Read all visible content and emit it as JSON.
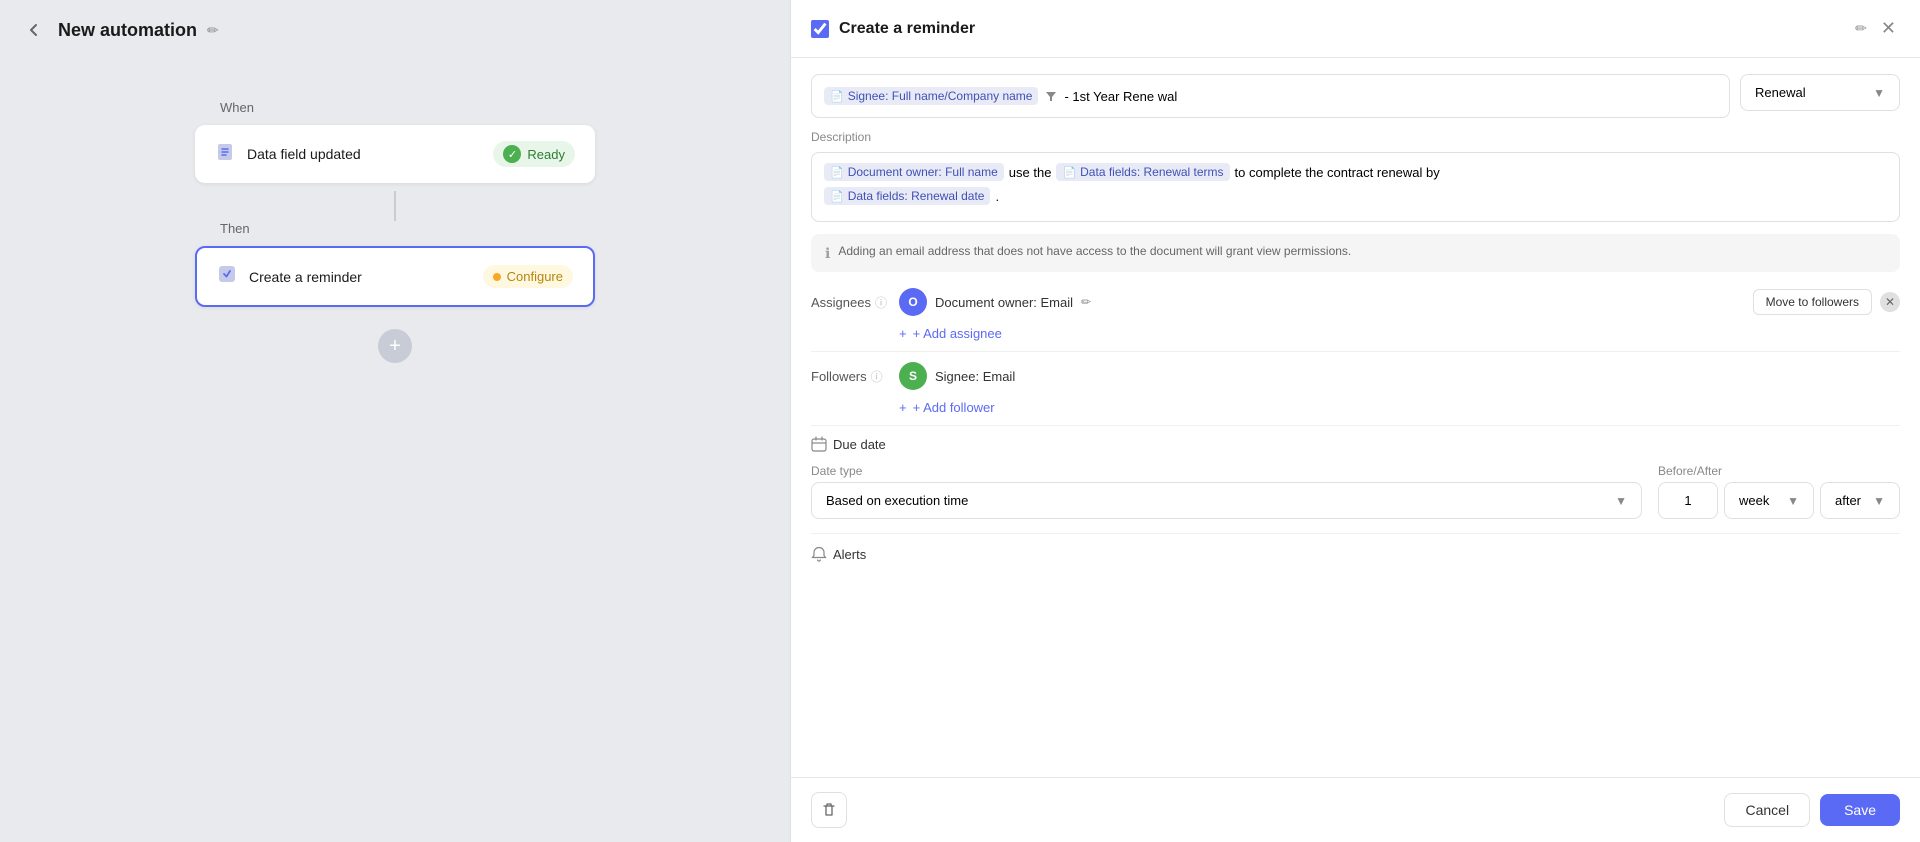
{
  "left": {
    "back_button": "‹",
    "title": "New automation",
    "edit_icon": "✏",
    "when_label": "When",
    "trigger_card": {
      "icon": "📄",
      "label": "Data field updated",
      "status": "Ready"
    },
    "then_label": "Then",
    "action_card": {
      "icon": "☑",
      "label": "Create a reminder",
      "status": "Configure"
    },
    "add_button": "+"
  },
  "right": {
    "title": "Create a reminder",
    "edit_icon": "✏",
    "close": "✕",
    "subject_field": {
      "token1_icon": "📄",
      "token1_label": "Signee: Full name/Company name",
      "filter_icon": "▼",
      "text": "- 1st Year Rene wal"
    },
    "subject_dropdown": "Renewal",
    "description_label": "Description",
    "desc_token1_icon": "📄",
    "desc_token1_label": "Document owner: Full name",
    "desc_text1": "use the",
    "desc_token2_icon": "📄",
    "desc_token2_label": "Data fields: Renewal terms",
    "desc_text2": "to complete the contract renewal by",
    "desc_token3_icon": "📄",
    "desc_token3_label": "Data fields: Renewal date",
    "info_text": "Adding an email address that does not have access to the document will grant view permissions.",
    "assignees_label": "Assignees",
    "assignee_name": "Document owner: Email",
    "move_followers_btn": "Move to followers",
    "add_assignee_label": "+ Add assignee",
    "followers_label": "Followers",
    "follower_name": "Signee: Email",
    "add_follower_label": "+ Add follower",
    "due_date_label": "Due date",
    "date_type_label": "Date type",
    "date_type_value": "Based on execution time",
    "before_after_label": "Before/After",
    "number_value": "1",
    "period_value": "week",
    "timing_value": "after",
    "alerts_label": "Alerts",
    "delete_icon": "🗑",
    "cancel_label": "Cancel",
    "save_label": "Save"
  }
}
